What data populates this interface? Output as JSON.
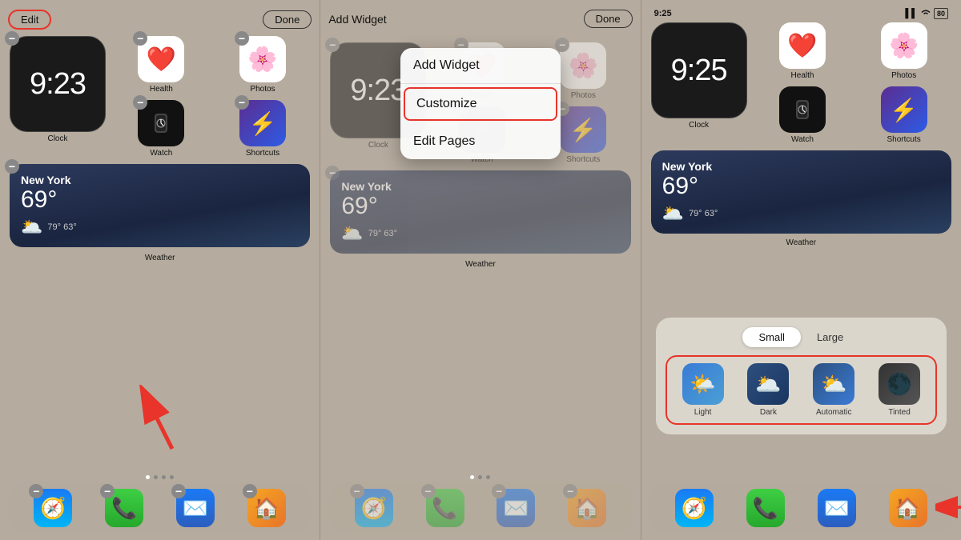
{
  "panels": [
    {
      "id": "panel1",
      "type": "edit",
      "topBar": {
        "editLabel": "Edit",
        "doneLabel": "Done",
        "editHighlighted": true
      },
      "clock": {
        "time": "9:23"
      },
      "apps": {
        "health": "Health",
        "photos": "Photos",
        "watch": "Watch",
        "shortcuts": "Shortcuts",
        "clock": "Clock"
      },
      "weather": {
        "city": "New York",
        "temp": "69°",
        "range": "79° 63°",
        "label": "Weather"
      },
      "dock": [
        "Safari",
        "Phone",
        "Mail",
        "Home"
      ],
      "showMinusBadges": true,
      "showArrow": true
    },
    {
      "id": "panel2",
      "type": "context",
      "topBar": {
        "editLabel": "Add Widget",
        "doneLabel": "Done"
      },
      "contextMenu": {
        "items": [
          "Add Widget",
          "Customize",
          "Edit Pages"
        ],
        "highlighted": "Customize"
      },
      "clock": {
        "time": "9:23"
      },
      "weather": {
        "city": "New York",
        "temp": "69°",
        "range": "79° 63°",
        "label": "Weather"
      },
      "dock": [
        "Safari",
        "Phone",
        "Mail",
        "Home"
      ],
      "showMinusBadges": true
    },
    {
      "id": "panel3",
      "type": "customize",
      "statusBar": {
        "time": "9:25",
        "battery": "80"
      },
      "clock": {
        "time": "9:25"
      },
      "apps": {
        "health": "Health",
        "photos": "Photos",
        "watch": "Watch",
        "shortcuts": "Shortcuts",
        "clock": "Clock"
      },
      "weather": {
        "city": "New York",
        "temp": "69°",
        "range": "79° 63°",
        "label": "Weather"
      },
      "dock": [
        "Safari",
        "Phone",
        "Mail",
        "Home"
      ],
      "bottomSheet": {
        "toggleOptions": [
          "Small",
          "Large"
        ],
        "activeToggle": "Small",
        "options": [
          {
            "id": "light",
            "label": "Light"
          },
          {
            "id": "dark",
            "label": "Dark"
          },
          {
            "id": "auto",
            "label": "Automatic"
          },
          {
            "id": "tinted",
            "label": "Tinted"
          }
        ]
      }
    }
  ],
  "colors": {
    "red": "#e8342a",
    "darkBg": "#1a2540",
    "phoneBg": "#b5ab9e"
  }
}
